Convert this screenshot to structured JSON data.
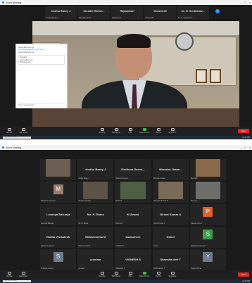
{
  "shot1": {
    "window_title": "Zoom Meeting",
    "participants": [
      {
        "name": "sindhu Basey J",
        "sub": "sindhu Basey J"
      },
      {
        "name": "Shradhi Harish...",
        "sub": "Shradhi Harish..."
      },
      {
        "name": "Rajashwari",
        "sub": "Rajashwari"
      },
      {
        "name": "dhusia143",
        "sub": "dhusia143"
      },
      {
        "name": "Dr. N. Senthamiz...",
        "sub": "Dr. N. Senthamiz..."
      }
    ],
    "chat": {
      "lines": [
        "Good afternoon sir",
        "From Basavaraj B to Everyone:",
        "Good Afternoon sir"
      ],
      "box": [
        "Namaste",
        "Good afternoon",
        "Thank you sir"
      ],
      "input": "Type message here..."
    },
    "toolbar": [
      "Unmute",
      "Start Video",
      "Security",
      "Participants",
      "Chat",
      "Share Screen",
      "Record",
      "Reactions"
    ],
    "end_label": "End",
    "taskbar_search": "Type here to search",
    "clock": "12:42 PM"
  },
  "shot2": {
    "window_title": "Zoom Meeting",
    "tiles": [
      {
        "name": "",
        "sub": "",
        "kind": "cam",
        "color": "#6b5d4f"
      },
      {
        "name": "sindhu Basey J",
        "sub": "sindhu Basey J",
        "kind": "name"
      },
      {
        "name": "Sindhura Ganes...",
        "sub": "Sindhura Ganes...",
        "kind": "name"
      },
      {
        "name": "Monisha Jhaaa...",
        "sub": "Monisha Jhaaa...",
        "kind": "name"
      },
      {
        "name": "",
        "sub": "Jaya Rani",
        "kind": "cam",
        "color": "#8a6a4a"
      },
      {
        "name": "",
        "sub": "Madhavan Lakshmi",
        "kind": "avatar",
        "letter": "M",
        "color": "#9a7a6e"
      },
      {
        "name": "",
        "sub": "Sandhya Nyatha...",
        "kind": "cam",
        "color": "#5d5248"
      },
      {
        "name": "",
        "sub": "Rishabh",
        "kind": "cam",
        "color": "#4f5f44"
      },
      {
        "name": "",
        "sub": "Mahendra Kumar M",
        "kind": "cam",
        "color": "#7a6a58"
      },
      {
        "name": "",
        "sub": "Ramesh",
        "kind": "cam",
        "color": "#6e6e68"
      },
      {
        "name": "Lavanya Baleraju",
        "sub": "Lavanya Baleraju",
        "kind": "name"
      },
      {
        "name": "Ms. R. Rama",
        "sub": "Ms. R. Rama",
        "kind": "name"
      },
      {
        "name": "M.Anand",
        "sub": "M.Anand",
        "kind": "name"
      },
      {
        "name": "Nirmal Kumar A",
        "sub": "Nirmal Kumar A",
        "kind": "name"
      },
      {
        "name": "",
        "sub": "pradeep kumar",
        "kind": "avatar",
        "letter": "P",
        "color": "#e0622b"
      },
      {
        "name": "Radha Venkatesh",
        "sub": "Radha Venkatesh",
        "kind": "name"
      },
      {
        "name": "Meharunnisa M",
        "sub": "Meharunnisa M",
        "kind": "name"
      },
      {
        "name": "saraschree",
        "sub": "saraschree",
        "kind": "name"
      },
      {
        "name": "Gokul",
        "sub": "Gokul",
        "kind": "name"
      },
      {
        "name": "",
        "sub": "Sasikala Sivakumar",
        "kind": "avatar",
        "letter": "S",
        "color": "#3aa04a"
      },
      {
        "name": "",
        "sub": "Sharmila Sowmiy",
        "kind": "avatar",
        "letter": "S",
        "color": "#6d7b8a"
      },
      {
        "name": "yuvnaar",
        "sub": "yuvnaar",
        "kind": "name"
      },
      {
        "name": "VIGNESH S",
        "sub": "VIGNESH S",
        "kind": "name"
      },
      {
        "name": "Sharmila devi T",
        "sub": "Sharmila devi T",
        "kind": "name"
      },
      {
        "name": "",
        "sub": "Yogesh kumar",
        "kind": "avatar",
        "letter": "Y",
        "color": "#6d7b8a"
      }
    ],
    "toolbar": [
      "Unmute",
      "Start Video",
      "Security",
      "Participants",
      "Chat",
      "Share Screen",
      "Record",
      "Reactions"
    ],
    "end_label": "End",
    "taskbar_search": "Type here to search",
    "clock": "12:44 PM"
  }
}
